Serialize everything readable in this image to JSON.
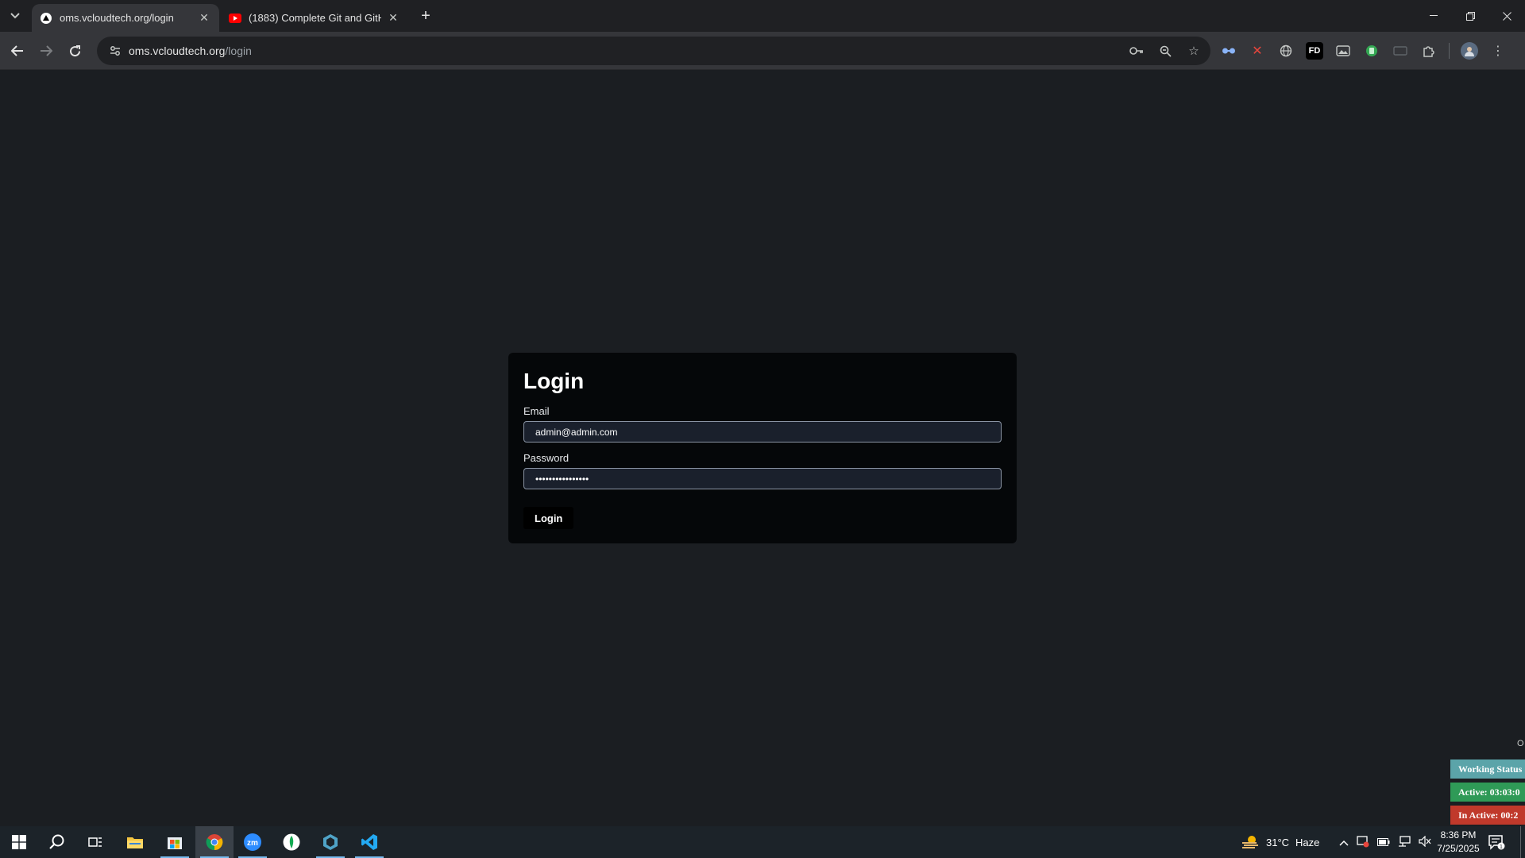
{
  "browser": {
    "tabs": [
      {
        "title": "oms.vcloudtech.org/login",
        "favicon": "vercel-triangle-icon",
        "active": true
      },
      {
        "title": "(1883) Complete Git and GitHub",
        "favicon": "youtube-icon",
        "active": false
      }
    ],
    "url_host": "oms.vcloudtech.org",
    "url_path": "/login"
  },
  "login": {
    "title": "Login",
    "email_label": "Email",
    "email_value": "admin@admin.com",
    "password_label": "Password",
    "password_value": "••••••••••••••••",
    "button_label": "Login"
  },
  "tracker": {
    "corner_letter": "O",
    "status_label": "Working Status",
    "active_label": "Active: 03:03:0",
    "inactive_label": "In Active: 00:2"
  },
  "taskbar": {
    "weather_temp": "31°C",
    "weather_desc": "Haze",
    "time": "8:36 PM",
    "date": "7/25/2025",
    "notification_count": "1"
  },
  "colors": {
    "page_bg": "#1b1e22",
    "card_bg": "#050709",
    "status_teal": "#5ba4a9",
    "active_green": "#2f9a57",
    "inactive_red": "#c0392b"
  }
}
